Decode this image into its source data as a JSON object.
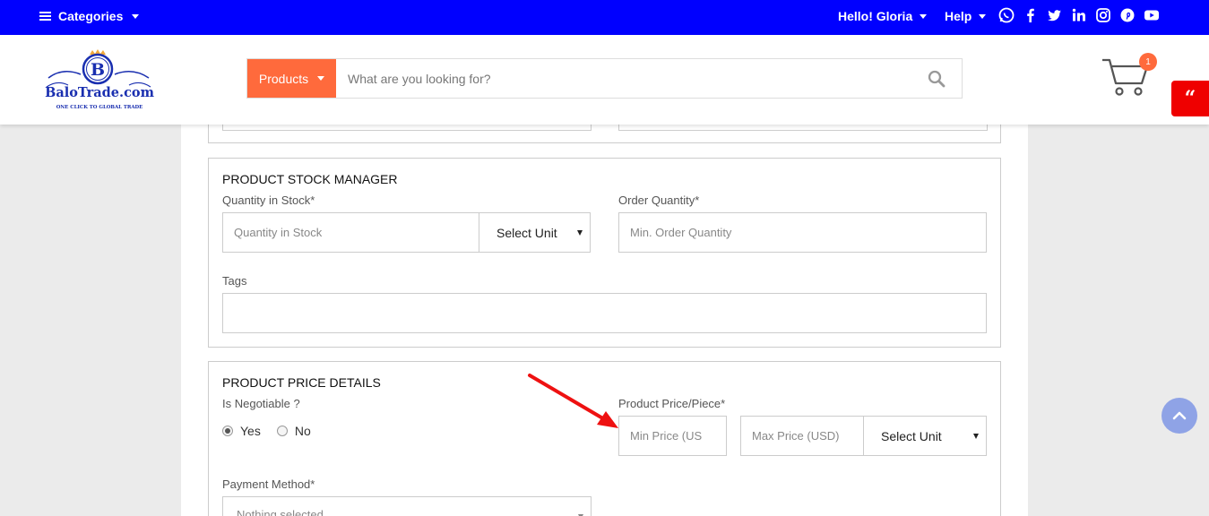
{
  "topbar": {
    "categories_label": "Categories",
    "greeting": "Hello! Gloria",
    "help_label": "Help",
    "social_icons": [
      "whatsapp-icon",
      "facebook-icon",
      "twitter-icon",
      "linkedin-icon",
      "instagram-icon",
      "pinterest-icon",
      "youtube-icon"
    ],
    "bg_color": "#0000ff"
  },
  "header": {
    "logo": {
      "initial": "B",
      "name": "BaloTrade.com",
      "tagline": "ONE CLICK TO GLOBAL TRADE"
    },
    "search": {
      "category_label": "Products",
      "placeholder": "What are you looking for?"
    },
    "cart_count": "1",
    "accent_color": "#ff6a3c"
  },
  "stock_manager": {
    "title": "PRODUCT STOCK MANAGER",
    "quantity_label": "Quantity in Stock*",
    "quantity_placeholder": "Quantity in Stock",
    "unit_select": "Select Unit",
    "order_qty_label": "Order Quantity*",
    "order_qty_placeholder": "Min. Order Quantity",
    "tags_label": "Tags",
    "tags_value": ""
  },
  "price_details": {
    "title": "PRODUCT PRICE DETAILS",
    "negotiable_label": "Is Negotiable ?",
    "options": [
      {
        "label": "Yes",
        "selected": true
      },
      {
        "label": "No",
        "selected": false
      }
    ],
    "price_label": "Product Price/Piece*",
    "min_price_placeholder": "Min Price (US",
    "max_price_placeholder": "Max Price (USD)",
    "unit_select": "Select Unit",
    "payment_label": "Payment Method*",
    "payment_select": "Nothing selected"
  }
}
